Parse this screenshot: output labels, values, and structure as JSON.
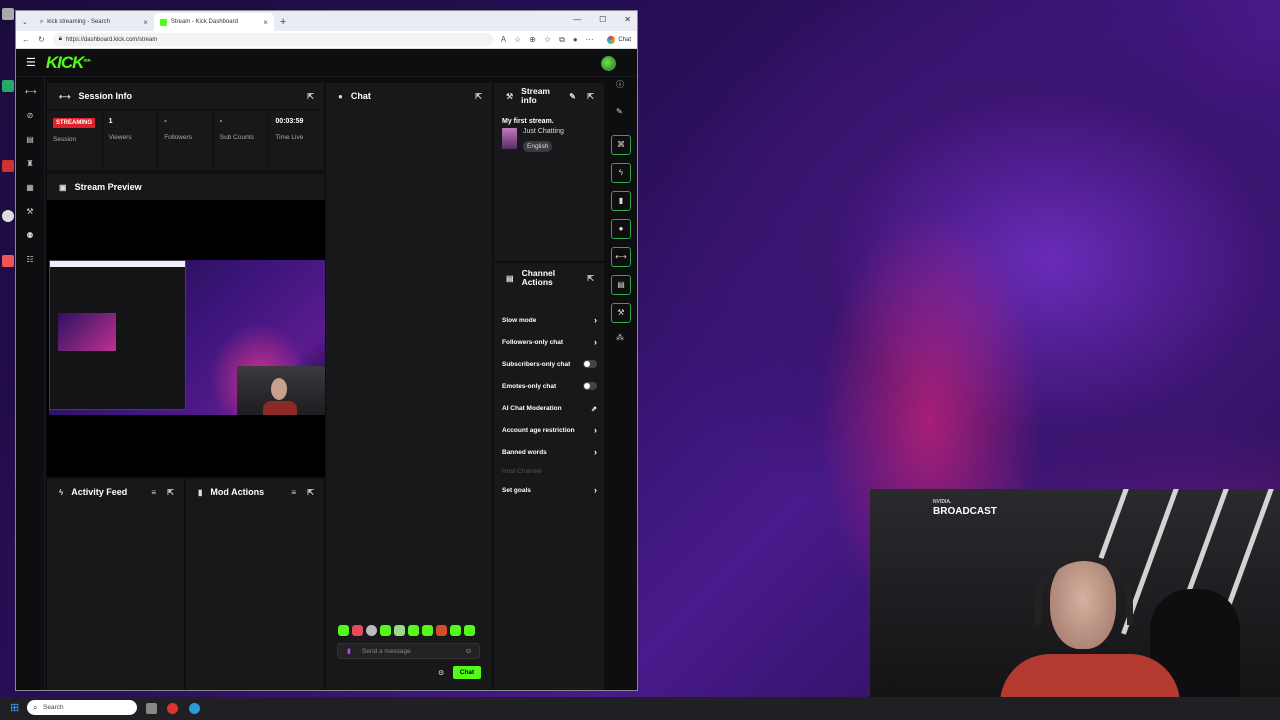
{
  "browser": {
    "tabs": [
      {
        "label": "kick streaming - Search",
        "active": false
      },
      {
        "label": "Stream - Kick Dashboard",
        "active": true
      }
    ],
    "url": "https://dashboard.kick.com/stream",
    "chat_label": "Chat"
  },
  "kick": {
    "logo": "KICK",
    "logo_tag": "BETA",
    "session": {
      "title": "Session Info",
      "status_badge": "STREAMING",
      "status_label": "Session",
      "stats": [
        {
          "value": "1",
          "label": "Viewers"
        },
        {
          "value": "-",
          "label": "Followers"
        },
        {
          "value": "-",
          "label": "Sub Counts"
        },
        {
          "value": "00:03:59",
          "label": "Time Live"
        }
      ]
    },
    "preview": {
      "title": "Stream Preview"
    },
    "activity": {
      "title": "Activity Feed"
    },
    "mod": {
      "title": "Mod Actions"
    },
    "chat": {
      "title": "Chat",
      "placeholder": "Send a message",
      "send_label": "Chat"
    },
    "stream_info": {
      "title_line1": "Stream",
      "title_line2": "info",
      "stream_title": "My first stream.",
      "category": "Just Chatting",
      "language": "English"
    },
    "channel_actions": {
      "title_line1": "Channel",
      "title_line2": "Actions",
      "items": [
        {
          "label": "Slow mode",
          "control": "arrow"
        },
        {
          "label": "Followers-only chat",
          "control": "arrow"
        },
        {
          "label": "Subscribers-only chat",
          "control": "toggle",
          "on": false
        },
        {
          "label": "Emotes-only chat",
          "control": "toggle",
          "on": false
        },
        {
          "label": "AI Chat Moderation",
          "control": "external"
        },
        {
          "label": "Account age restriction",
          "control": "arrow"
        },
        {
          "label": "Banned words",
          "control": "arrow"
        },
        {
          "label": "Host Channel",
          "control": "disabled"
        },
        {
          "label": "Set goals",
          "control": "arrow"
        }
      ]
    }
  },
  "taskbar": {
    "search_placeholder": "Search"
  },
  "overlay": {
    "brand_small": "NVIDIA.",
    "brand_large": "BROADCAST"
  },
  "colors": {
    "accent": "#53fc18",
    "live": "#e0202a",
    "panel": "#18181b",
    "bg": "#0e0e10"
  }
}
